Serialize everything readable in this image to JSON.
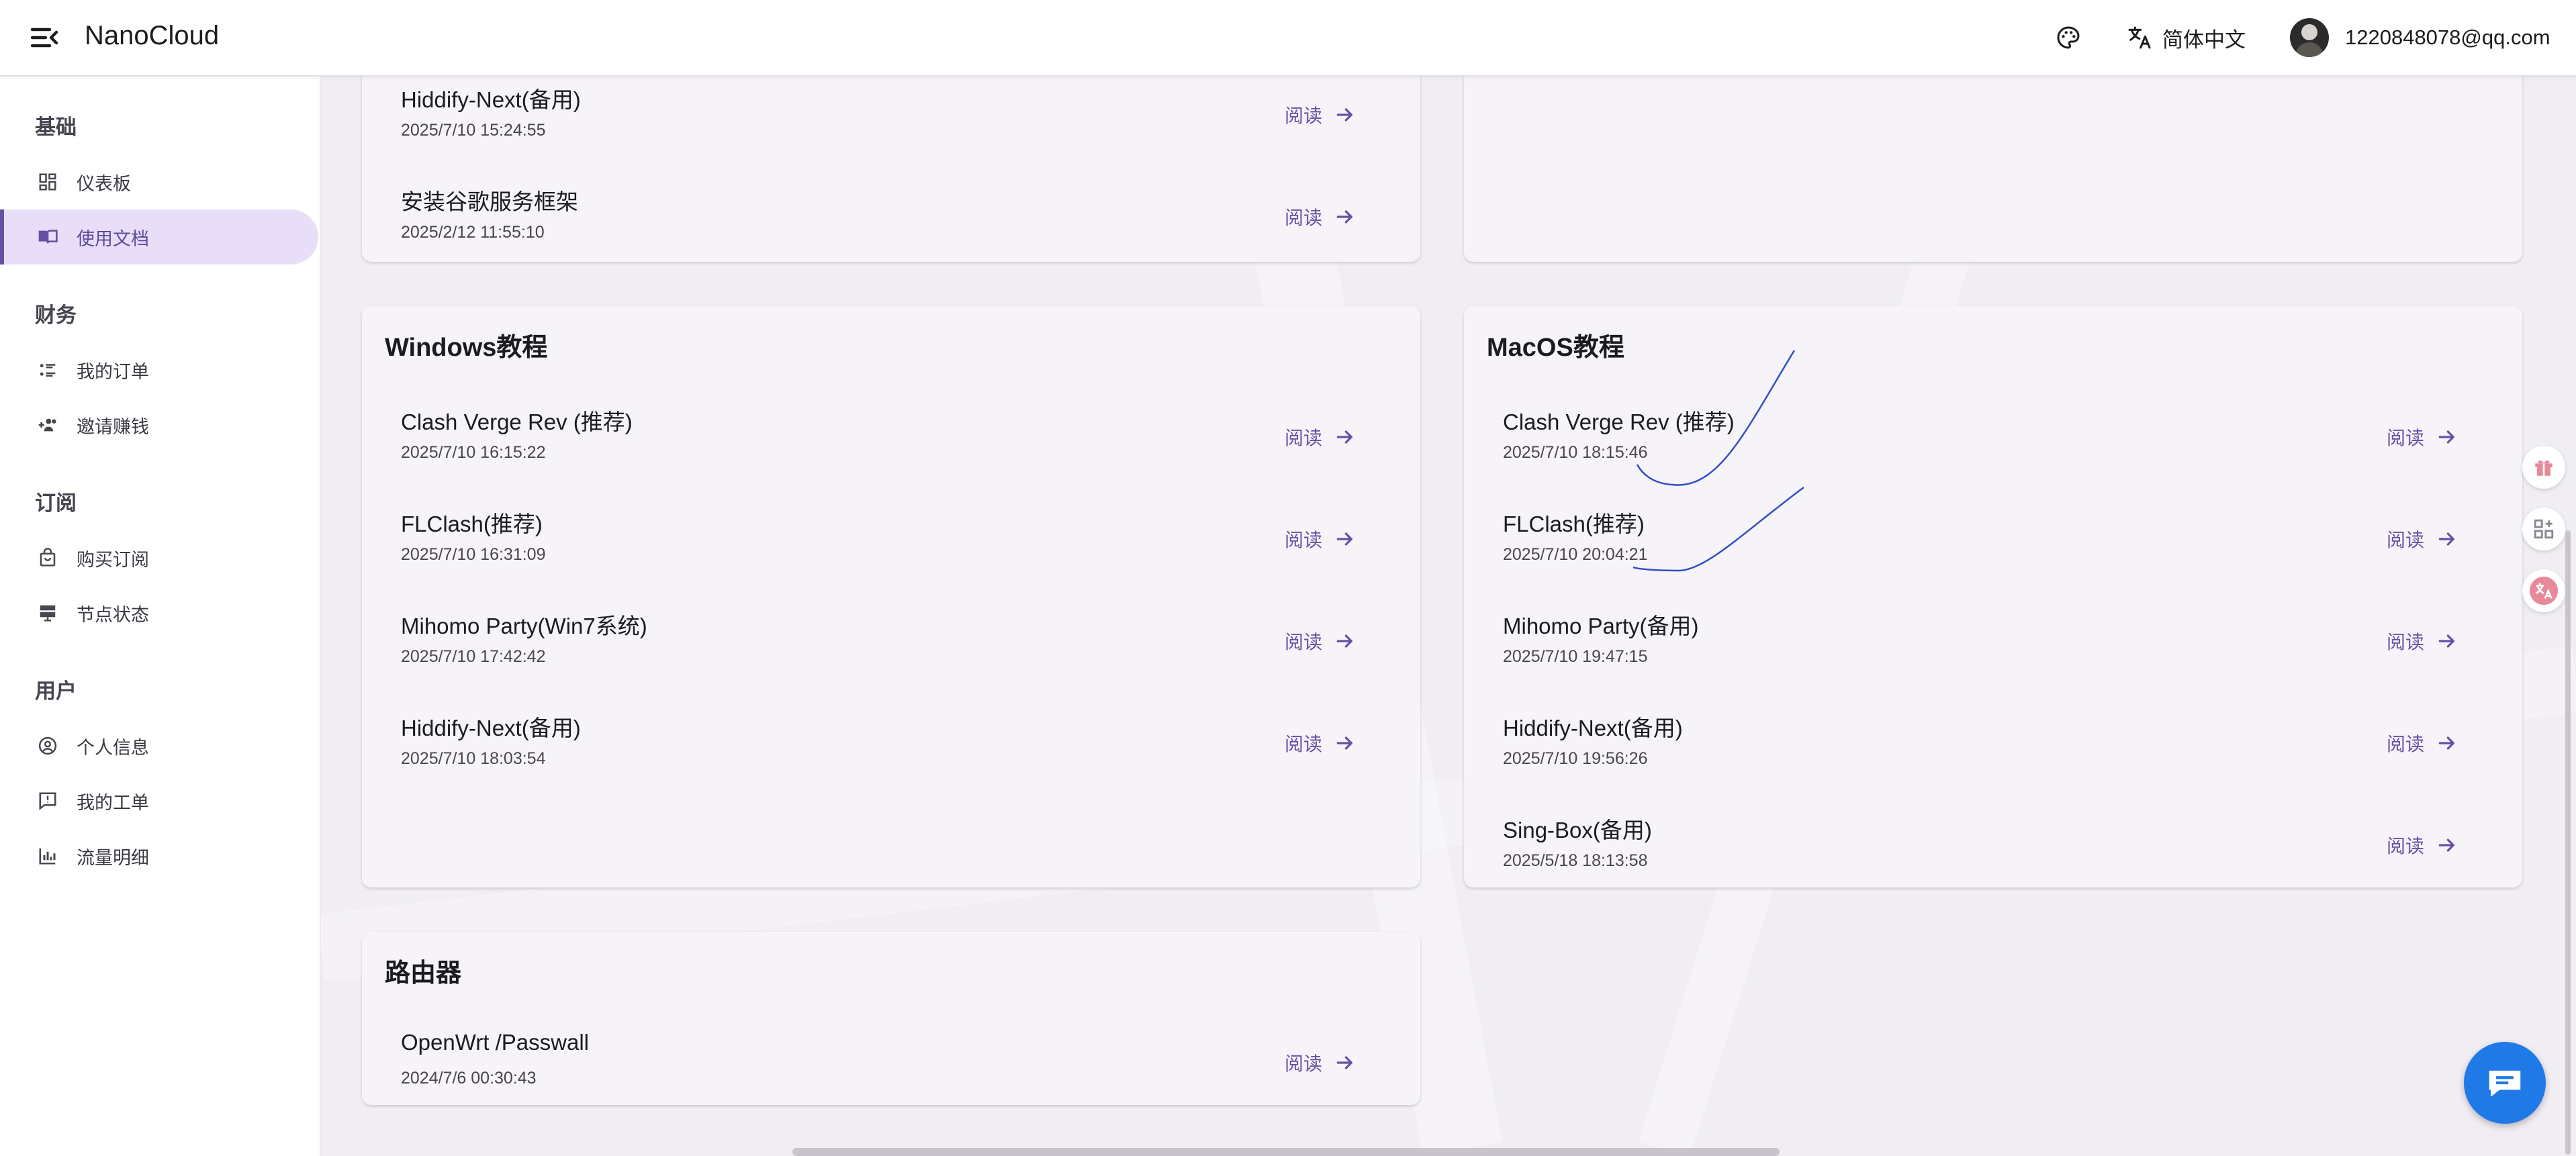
{
  "app": {
    "title": "NanoCloud"
  },
  "header": {
    "language": "简体中文",
    "user_email": "1220848078@qq.com"
  },
  "sidebar": {
    "sections": [
      {
        "title": "基础",
        "items": [
          {
            "label": "仪表板",
            "icon": "dashboard-icon"
          },
          {
            "label": "使用文档",
            "icon": "book-icon",
            "active": true
          }
        ]
      },
      {
        "title": "财务",
        "items": [
          {
            "label": "我的订单",
            "icon": "list-icon"
          },
          {
            "label": "邀请赚钱",
            "icon": "group-add-icon"
          }
        ]
      },
      {
        "title": "订阅",
        "items": [
          {
            "label": "购买订阅",
            "icon": "bag-icon"
          },
          {
            "label": "节点状态",
            "icon": "server-icon"
          }
        ]
      },
      {
        "title": "用户",
        "items": [
          {
            "label": "个人信息",
            "icon": "account-icon"
          },
          {
            "label": "我的工单",
            "icon": "ticket-icon"
          },
          {
            "label": "流量明细",
            "icon": "bar-chart-icon"
          }
        ]
      }
    ]
  },
  "cards": {
    "top_left": {
      "rows": [
        {
          "name": "Hiddify-Next(备用)",
          "date": "2025/7/10 15:24:55"
        },
        {
          "name": "安装谷歌服务框架",
          "date": "2025/2/12 11:55:10"
        }
      ]
    },
    "windows": {
      "title": "Windows教程",
      "rows": [
        {
          "name": "Clash Verge Rev (推荐)",
          "date": "2025/7/10 16:15:22"
        },
        {
          "name": "FLClash(推荐)",
          "date": "2025/7/10 16:31:09"
        },
        {
          "name": "Mihomo Party(Win7系统)",
          "date": "2025/7/10 17:42:42"
        },
        {
          "name": "Hiddify-Next(备用)",
          "date": "2025/7/10 18:03:54"
        }
      ]
    },
    "macos": {
      "title": "MacOS教程",
      "rows": [
        {
          "name": "Clash Verge Rev (推荐)",
          "date": "2025/7/10 18:15:46"
        },
        {
          "name": "FLClash(推荐)",
          "date": "2025/7/10 20:04:21"
        },
        {
          "name": "Mihomo Party(备用)",
          "date": "2025/7/10 19:47:15"
        },
        {
          "name": "Hiddify-Next(备用)",
          "date": "2025/7/10 19:56:26"
        },
        {
          "name": "Sing-Box(备用)",
          "date": "2025/5/18 18:13:58"
        }
      ]
    },
    "router": {
      "title": "路由器",
      "rows": [
        {
          "name": "OpenWrt /Passwall",
          "date": "2024/7/6 00:30:43"
        }
      ]
    }
  },
  "read_label": "阅读",
  "colors": {
    "accent": "#6750a4",
    "active_bg": "#e8def8",
    "chat_button": "#1f7ae8",
    "floating_icons": "#e8899a"
  }
}
